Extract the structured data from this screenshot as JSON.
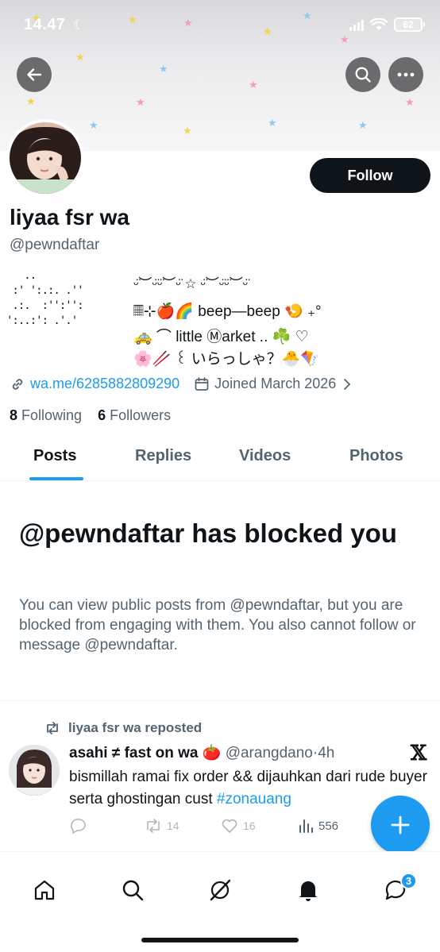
{
  "status_bar": {
    "time": "14.47",
    "battery": "62"
  },
  "profile": {
    "display_name": "liyaa fsr wa",
    "handle": "@pewndaftar",
    "follow_label": "Follow",
    "bio_art": "   ..\n :' ':.:. .''\n .:.  :'':'':\n':..:': .'.'",
    "bio_lines": [
      "ᵕ̈︶ᵕ̈ᵕ̈︶ᵕ̈ ☆ ᵕ̈︶ᵕ̈ᵕ̈︶ᵕ̈",
      "𝄜⊹🍎🌈 beep—beep 🍤 ₊°",
      "🚕 ⌒ little Ⓜarket .. ☘️ ♡",
      "🌸🥢 ꒰ いらっしゃ？🐣🪁"
    ],
    "link": "wa.me/6285882809290",
    "joined": "Joined March 2026",
    "following_count": "8",
    "following_label": "Following",
    "followers_count": "6",
    "followers_label": "Followers"
  },
  "tabs": [
    "Posts",
    "Replies",
    "Videos",
    "Photos"
  ],
  "blocked": {
    "title": "@pewndaftar has blocked you",
    "description": "You can view public posts from @pewndaftar, but you are blocked from engaging with them. You also cannot follow or message @pewndaftar."
  },
  "post": {
    "repost_label": "liyaa fsr wa reposted",
    "author": "asahi ≠ fast on wa 🍅",
    "handle": "@arangdano",
    "separator": "·",
    "time": "4h",
    "text": "bismillah ramai fix order && dijauhkan dari rude buyer serta ghostingan cust",
    "hashtag": "#zonauang",
    "reposts": "14",
    "likes": "16",
    "views": "556"
  },
  "nav": {
    "messages_badge": "3"
  },
  "colors": {
    "accent": "#1d9bf0",
    "text": "#0f1419",
    "muted": "#536471"
  }
}
